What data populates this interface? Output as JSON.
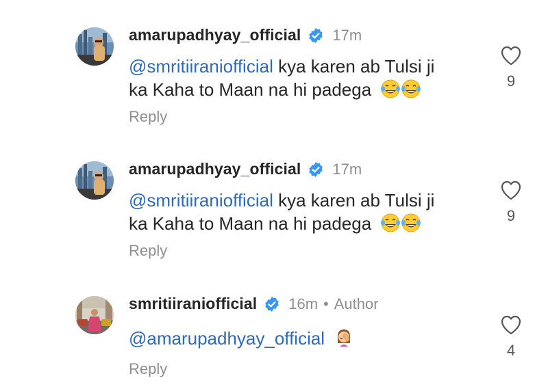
{
  "comments": [
    {
      "username": "amarupadhyay_official",
      "time": "17m",
      "mention": "@smritiiraniofficial",
      "text_line1": " kya karen ab Tulsi ji",
      "text_line2": "ka Kaha to Maan na hi padega",
      "emoji": "face-with-tears-of-joy x2",
      "reply_label": "Reply",
      "likes": "9"
    },
    {
      "username": "amarupadhyay_official",
      "time": "17m",
      "mention": "@smritiiraniofficial",
      "text_line1": " kya karen ab Tulsi ji",
      "text_line2": "ka Kaha to Maan na hi padega",
      "emoji": "face-with-tears-of-joy x2",
      "reply_label": "Reply",
      "likes": "9"
    },
    {
      "username": "smritiiraniofficial",
      "time": "16m",
      "separator": "•",
      "badge": "Author",
      "mention": "@amarupadhyay_official",
      "emoji": "woman-facepalming",
      "reply_label": "Reply",
      "likes": "4"
    }
  ],
  "colors": {
    "mention": "#2f6ab8",
    "verified": "#3897f0",
    "muted": "#8e8e8e",
    "text": "#262626",
    "emoji_face": "#ffcc33"
  }
}
